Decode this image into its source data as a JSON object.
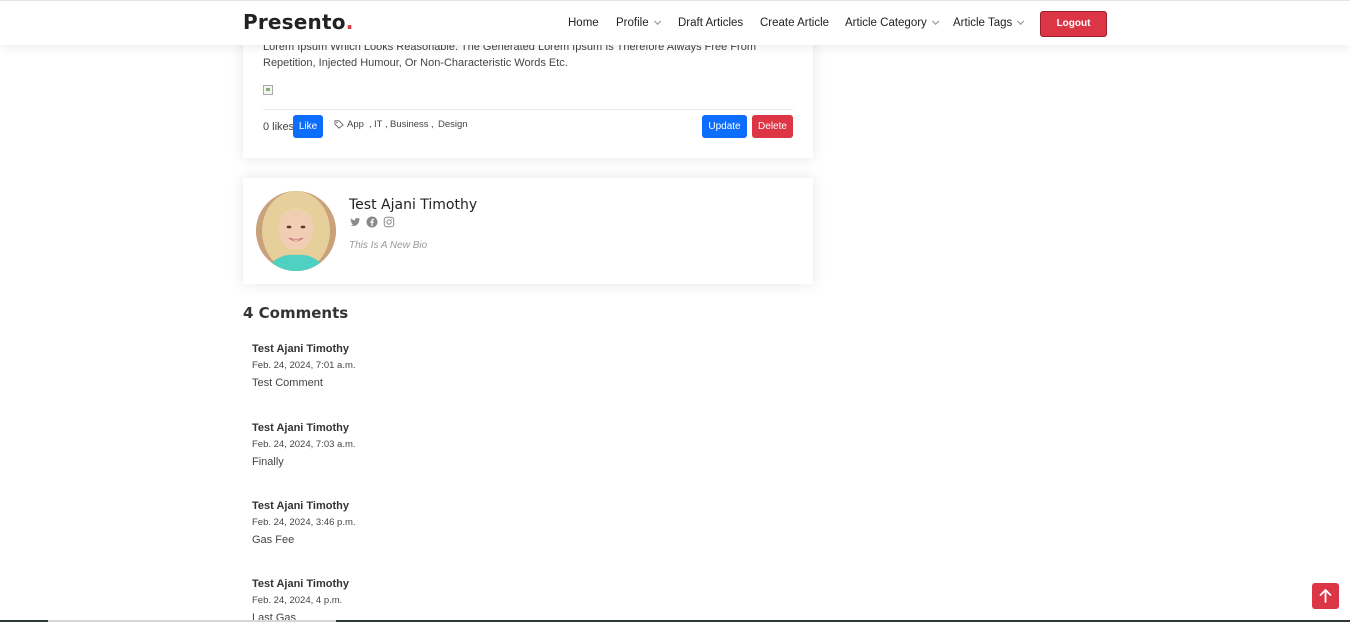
{
  "brand": {
    "name": "Presento",
    "dot": "."
  },
  "nav": {
    "home": "Home",
    "profile": "Profile",
    "draft_articles": "Draft Articles",
    "create_article": "Create Article",
    "article_category": "Article Category",
    "article_tags": "Article Tags",
    "logout": "Logout"
  },
  "article": {
    "text": "Lorem Ipsum Which Looks Reasonable. The Generated Lorem Ipsum Is Therefore Always Free From Repetition, Injected Humour, Or Non-Characteristic Words Etc.",
    "likes_text": "0 likes",
    "like_label": "Like",
    "tags": [
      "App",
      "IT",
      "Business",
      "Design"
    ],
    "tag_separator": ",",
    "update_label": "Update",
    "delete_label": "Delete"
  },
  "author": {
    "name": "Test Ajani Timothy",
    "bio": "This Is A New Bio",
    "socials": [
      "twitter-icon",
      "facebook-icon",
      "instagram-icon"
    ]
  },
  "comments": {
    "title": "4 Comments",
    "items": [
      {
        "author": "Test Ajani Timothy",
        "date": "Feb. 24, 2024, 7:01 a.m.",
        "text": "Test Comment"
      },
      {
        "author": "Test Ajani Timothy",
        "date": "Feb. 24, 2024, 7:03 a.m.",
        "text": "Finally"
      },
      {
        "author": "Test Ajani Timothy",
        "date": "Feb. 24, 2024, 3:46 p.m.",
        "text": "Gas Fee"
      },
      {
        "author": "Test Ajani Timothy",
        "date": "Feb. 24, 2024, 4 p.m.",
        "text": "Last Gas"
      }
    ]
  },
  "colors": {
    "primary": "#0d6efd",
    "danger": "#dc3545",
    "brand_dot": "#e03a3c"
  },
  "icons": {
    "back_to_top": "arrow-up-icon",
    "tag": "tag-icon"
  }
}
